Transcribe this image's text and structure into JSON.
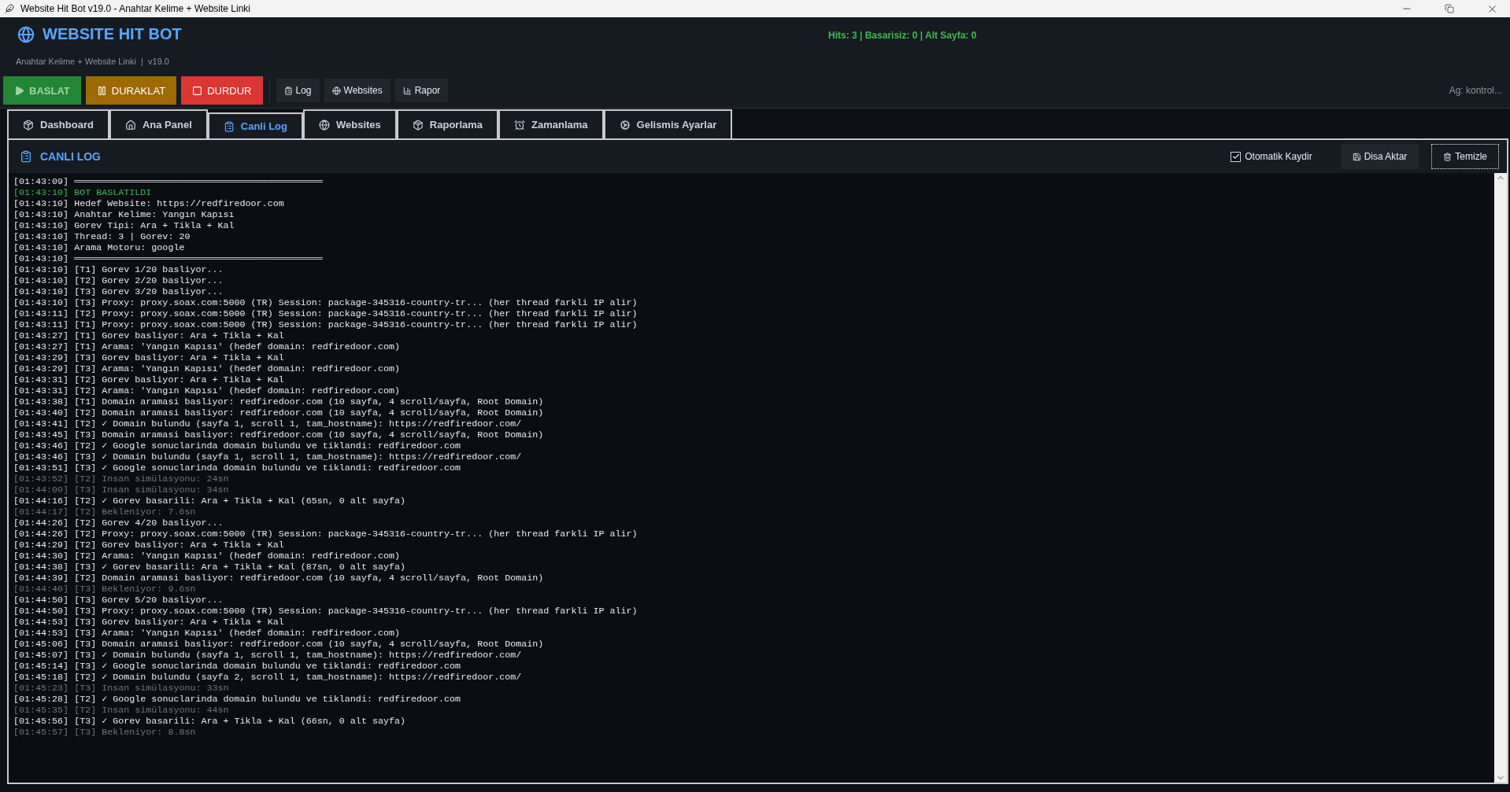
{
  "window": {
    "title": "Website Hit Bot v19.0 - Anahtar Kelime + Website Linki"
  },
  "header": {
    "title": "WEBSITE HIT BOT",
    "subtitle": "Anahtar Kelime + Website Linki  |  v19.0",
    "stats": "Hits: 3 | Basarisiz: 0 | Alt Sayfa: 0"
  },
  "toolbar": {
    "actions": [
      {
        "label": "BASLAT",
        "kind": "start",
        "disabled": true
      },
      {
        "label": "DURAKLAT",
        "kind": "pause",
        "disabled": false
      },
      {
        "label": "DURDUR",
        "kind": "stop",
        "disabled": false
      }
    ],
    "tools": [
      {
        "label": "Log",
        "kind": "log"
      },
      {
        "label": "Websites",
        "kind": "globe"
      },
      {
        "label": "Rapor",
        "kind": "chart"
      }
    ],
    "network_status": "Ag: kontrol..."
  },
  "tabs": [
    {
      "label": "Dashboard",
      "kind": "box",
      "selected": false
    },
    {
      "label": "Ana Panel",
      "kind": "home",
      "selected": false
    },
    {
      "label": "Canli Log",
      "kind": "log",
      "selected": true
    },
    {
      "label": "Websites",
      "kind": "globe",
      "selected": false
    },
    {
      "label": "Raporlama",
      "kind": "box",
      "selected": false
    },
    {
      "label": "Zamanlama",
      "kind": "alarm",
      "selected": false
    },
    {
      "label": "Gelismis Ayarlar",
      "kind": "gear",
      "selected": false
    }
  ],
  "log_panel": {
    "title": "CANLI LOG",
    "auto_scroll": {
      "label": "Otomatik Kaydir",
      "checked": true
    },
    "buttons": [
      {
        "label": "Disa Aktar",
        "kind": "save",
        "focused": false
      },
      {
        "label": "Temizle",
        "kind": "trash",
        "focused": true
      }
    ],
    "lines": [
      {
        "text": "[01:43:09] ═════════════════════════════════════════════",
        "kind": "info"
      },
      {
        "text": "[01:43:10] BOT BASLATILDI",
        "kind": "success"
      },
      {
        "text": "[01:43:10] Hedef Website: https://redfiredoor.com",
        "kind": "info"
      },
      {
        "text": "[01:43:10] Anahtar Kelime: Yangın Kapısı",
        "kind": "info"
      },
      {
        "text": "[01:43:10] Gorev Tipi: Ara + Tikla + Kal",
        "kind": "info"
      },
      {
        "text": "[01:43:10] Thread: 3 | Gorev: 20",
        "kind": "info"
      },
      {
        "text": "[01:43:10] Arama Motoru: google",
        "kind": "info"
      },
      {
        "text": "[01:43:10] ═════════════════════════════════════════════",
        "kind": "info"
      },
      {
        "text": "[01:43:10] [T1] Gorev 1/20 basliyor...",
        "kind": "info"
      },
      {
        "text": "[01:43:10] [T2] Gorev 2/20 basliyor...",
        "kind": "info"
      },
      {
        "text": "[01:43:10] [T3] Gorev 3/20 basliyor...",
        "kind": "info"
      },
      {
        "text": "[01:43:10] [T3] Proxy: proxy.soax.com:5000 (TR) Session: package-345316-country-tr... (her thread farkli IP alir)",
        "kind": "info"
      },
      {
        "text": "[01:43:11] [T2] Proxy: proxy.soax.com:5000 (TR) Session: package-345316-country-tr... (her thread farkli IP alir)",
        "kind": "info"
      },
      {
        "text": "[01:43:11] [T1] Proxy: proxy.soax.com:5000 (TR) Session: package-345316-country-tr... (her thread farkli IP alir)",
        "kind": "info"
      },
      {
        "text": "[01:43:27] [T1] Gorev basliyor: Ara + Tikla + Kal",
        "kind": "info"
      },
      {
        "text": "[01:43:27] [T1] Arama: 'Yangın Kapısı' (hedef domain: redfiredoor.com)",
        "kind": "info"
      },
      {
        "text": "[01:43:29] [T3] Gorev basliyor: Ara + Tikla + Kal",
        "kind": "info"
      },
      {
        "text": "[01:43:29] [T3] Arama: 'Yangın Kapısı' (hedef domain: redfiredoor.com)",
        "kind": "info"
      },
      {
        "text": "[01:43:31] [T2] Gorev basliyor: Ara + Tikla + Kal",
        "kind": "info"
      },
      {
        "text": "[01:43:31] [T2] Arama: 'Yangın Kapısı' (hedef domain: redfiredoor.com)",
        "kind": "info"
      },
      {
        "text": "[01:43:38] [T1] Domain aramasi basliyor: redfiredoor.com (10 sayfa, 4 scroll/sayfa, Root Domain)",
        "kind": "info"
      },
      {
        "text": "[01:43:40] [T2] Domain aramasi basliyor: redfiredoor.com (10 sayfa, 4 scroll/sayfa, Root Domain)",
        "kind": "info"
      },
      {
        "text": "[01:43:41] [T2] ✓ Domain bulundu (sayfa 1, scroll 1, tam_hostname): https://redfiredoor.com/",
        "kind": "info"
      },
      {
        "text": "[01:43:45] [T3] Domain aramasi basliyor: redfiredoor.com (10 sayfa, 4 scroll/sayfa, Root Domain)",
        "kind": "info"
      },
      {
        "text": "[01:43:46] [T2] ✓ Google sonuclarinda domain bulundu ve tiklandi: redfiredoor.com",
        "kind": "info"
      },
      {
        "text": "[01:43:46] [T3] ✓ Domain bulundu (sayfa 1, scroll 1, tam_hostname): https://redfiredoor.com/",
        "kind": "info"
      },
      {
        "text": "[01:43:51] [T3] ✓ Google sonuclarinda domain bulundu ve tiklandi: redfiredoor.com",
        "kind": "info"
      },
      {
        "text": "[01:43:52] [T2] Insan simülasyonu: 24sn",
        "kind": "muted"
      },
      {
        "text": "[01:44:00] [T3] Insan simülasyonu: 34sn",
        "kind": "muted"
      },
      {
        "text": "[01:44:16] [T2] ✓ Gorev basarili: Ara + Tikla + Kal (65sn, 0 alt sayfa)",
        "kind": "info"
      },
      {
        "text": "[01:44:17] [T2] Bekleniyor: 7.6sn",
        "kind": "muted"
      },
      {
        "text": "[01:44:26] [T2] Gorev 4/20 basliyor...",
        "kind": "info"
      },
      {
        "text": "[01:44:26] [T2] Proxy: proxy.soax.com:5000 (TR) Session: package-345316-country-tr... (her thread farkli IP alir)",
        "kind": "info"
      },
      {
        "text": "[01:44:29] [T2] Gorev basliyor: Ara + Tikla + Kal",
        "kind": "info"
      },
      {
        "text": "[01:44:30] [T2] Arama: 'Yangın Kapısı' (hedef domain: redfiredoor.com)",
        "kind": "info"
      },
      {
        "text": "[01:44:38] [T3] ✓ Gorev basarili: Ara + Tikla + Kal (87sn, 0 alt sayfa)",
        "kind": "info"
      },
      {
        "text": "[01:44:39] [T2] Domain aramasi basliyor: redfiredoor.com (10 sayfa, 4 scroll/sayfa, Root Domain)",
        "kind": "info"
      },
      {
        "text": "[01:44:40] [T3] Bekleniyor: 9.6sn",
        "kind": "muted"
      },
      {
        "text": "[01:44:50] [T3] Gorev 5/20 basliyor...",
        "kind": "info"
      },
      {
        "text": "[01:44:50] [T3] Proxy: proxy.soax.com:5000 (TR) Session: package-345316-country-tr... (her thread farkli IP alir)",
        "kind": "info"
      },
      {
        "text": "[01:44:53] [T3] Gorev basliyor: Ara + Tikla + Kal",
        "kind": "info"
      },
      {
        "text": "[01:44:53] [T3] Arama: 'Yangın Kapısı' (hedef domain: redfiredoor.com)",
        "kind": "info"
      },
      {
        "text": "[01:45:06] [T3] Domain aramasi basliyor: redfiredoor.com (10 sayfa, 4 scroll/sayfa, Root Domain)",
        "kind": "info"
      },
      {
        "text": "[01:45:07] [T3] ✓ Domain bulundu (sayfa 1, scroll 1, tam_hostname): https://redfiredoor.com/",
        "kind": "info"
      },
      {
        "text": "[01:45:14] [T3] ✓ Google sonuclarinda domain bulundu ve tiklandi: redfiredoor.com",
        "kind": "info"
      },
      {
        "text": "[01:45:18] [T2] ✓ Domain bulundu (sayfa 2, scroll 1, tam_hostname): https://redfiredoor.com/",
        "kind": "info"
      },
      {
        "text": "[01:45:23] [T3] Insan simülasyonu: 33sn",
        "kind": "muted"
      },
      {
        "text": "[01:45:28] [T2] ✓ Google sonuclarinda domain bulundu ve tiklandi: redfiredoor.com",
        "kind": "info"
      },
      {
        "text": "[01:45:35] [T2] Insan simülasyonu: 44sn",
        "kind": "muted"
      },
      {
        "text": "[01:45:56] [T3] ✓ Gorev basarili: Ara + Tikla + Kal (66sn, 0 alt sayfa)",
        "kind": "info"
      },
      {
        "text": "[01:45:57] [T3] Bekleniyor: 8.8sn",
        "kind": "muted"
      }
    ]
  }
}
